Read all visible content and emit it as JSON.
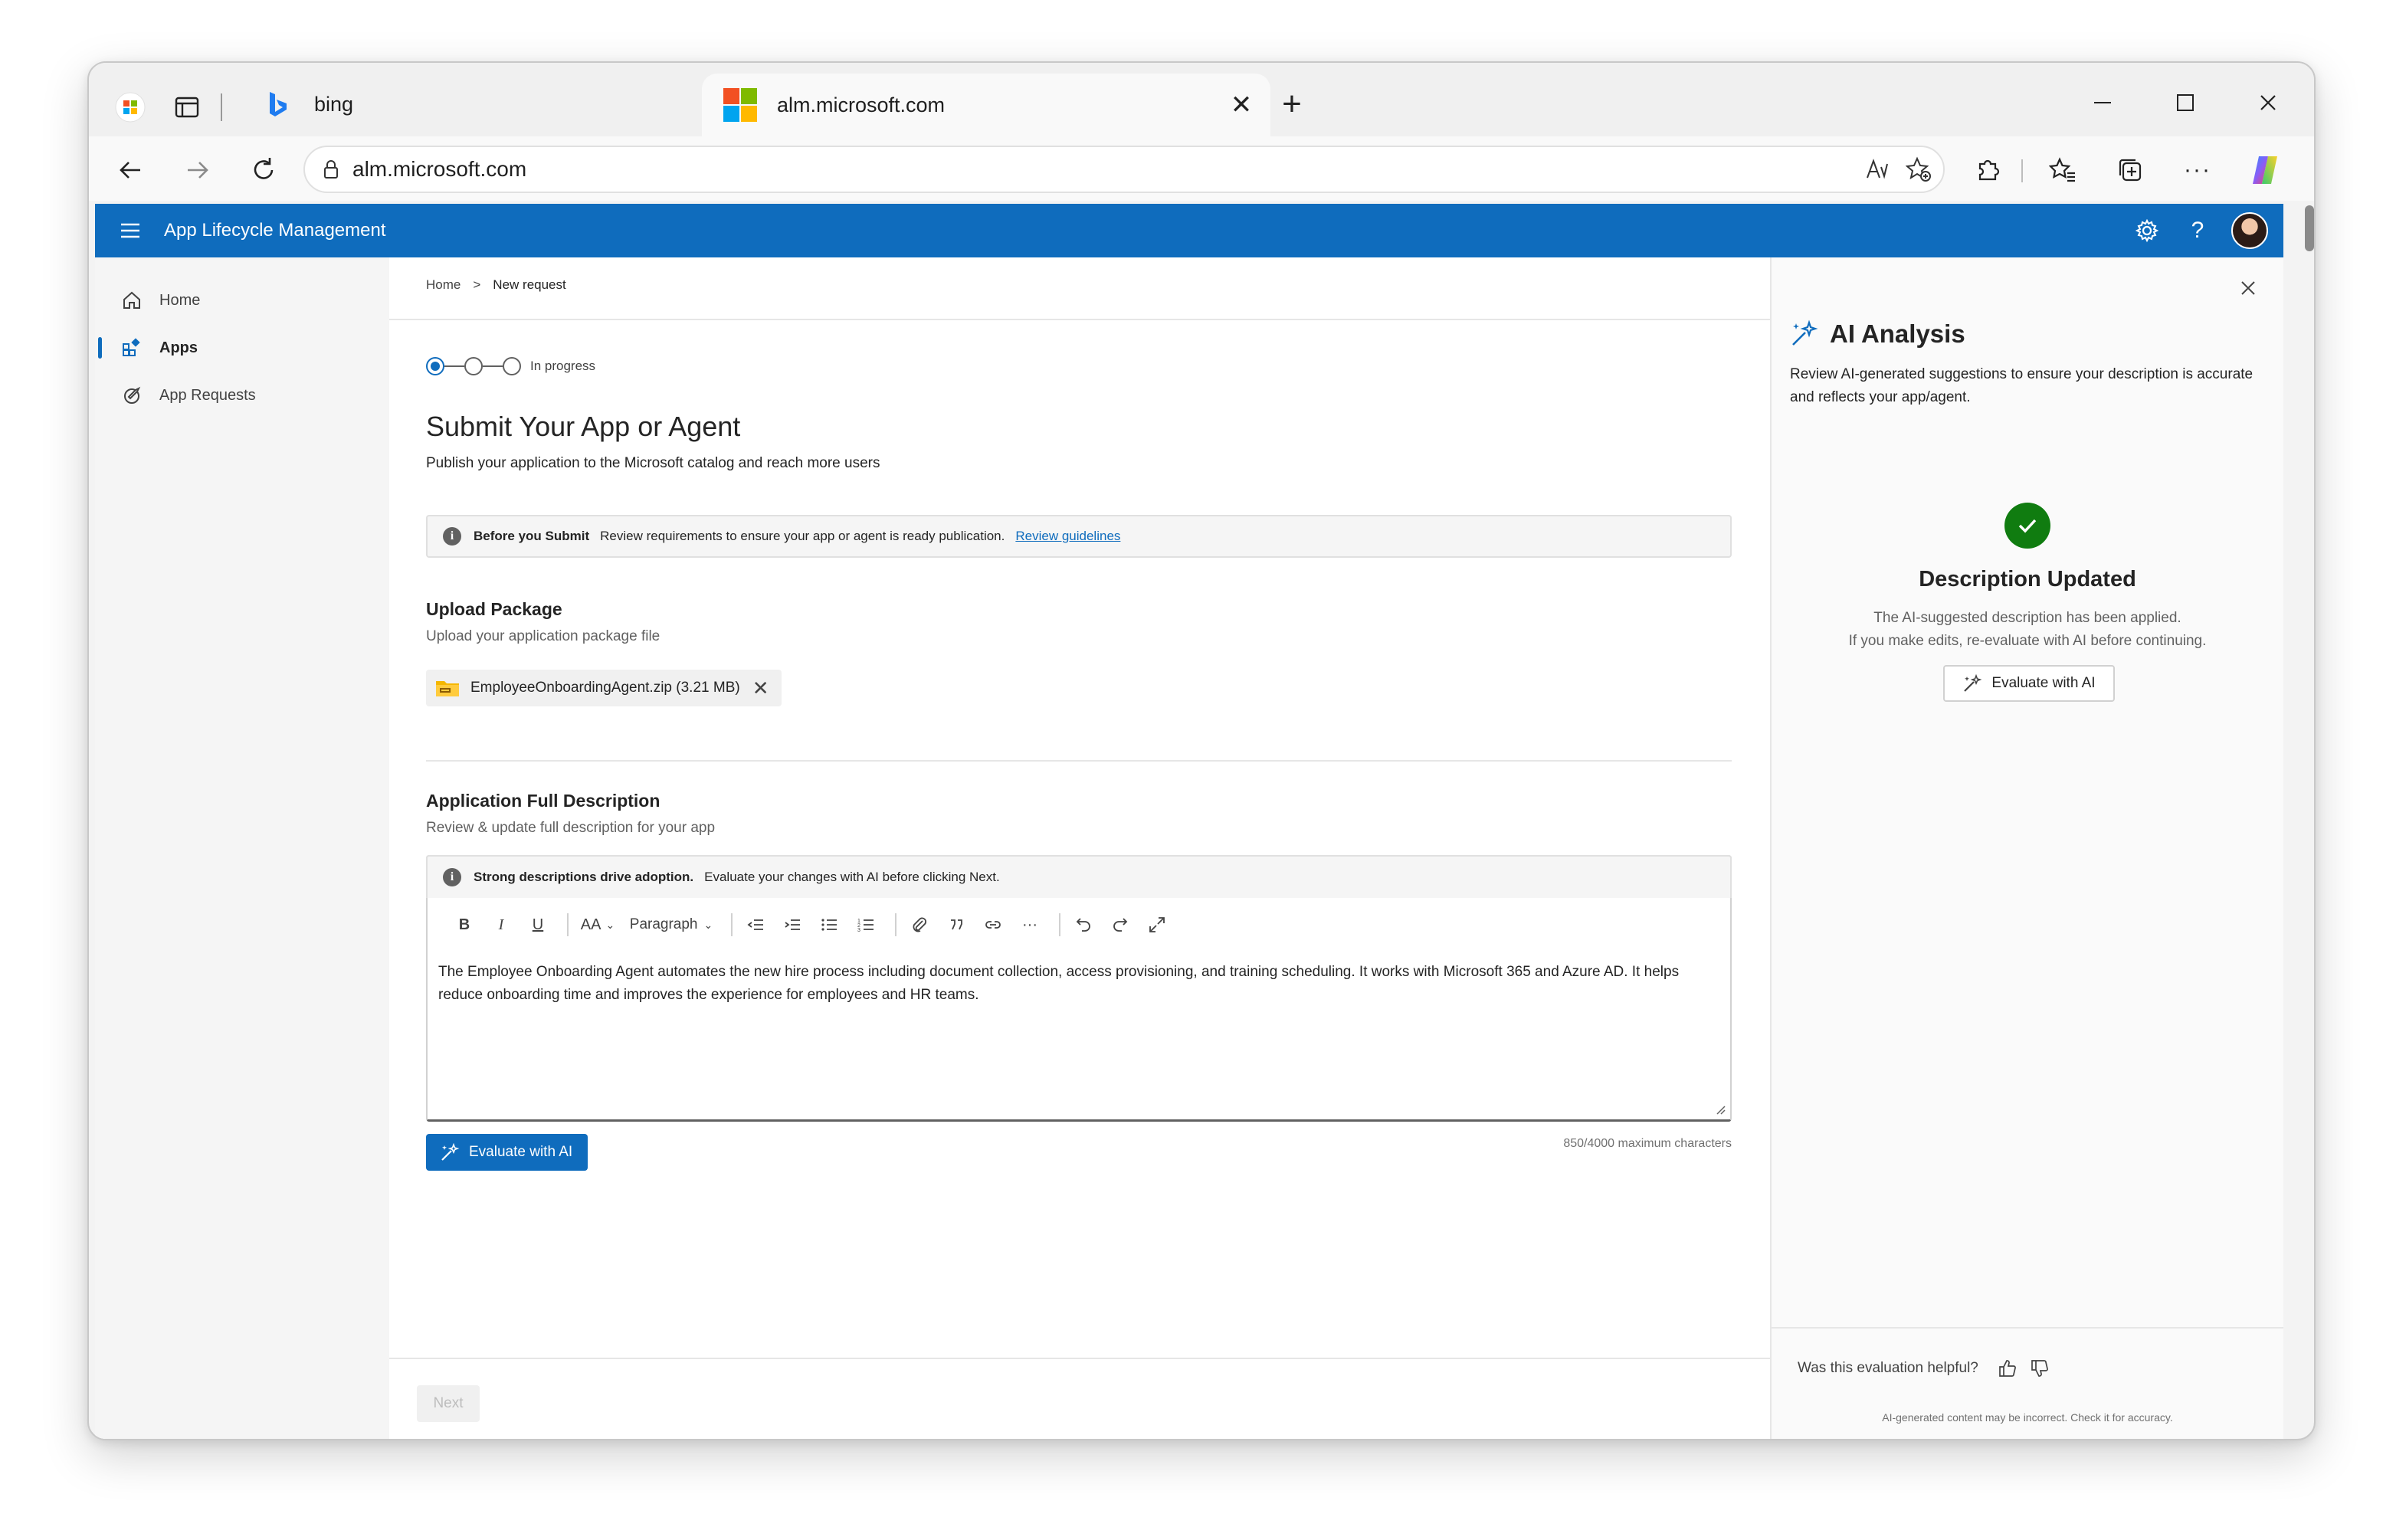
{
  "browser": {
    "tabs": [
      {
        "title": "bing",
        "active": false
      },
      {
        "title": "alm.microsoft.com",
        "active": true
      }
    ],
    "new_tab_label": "+",
    "close_glyph": "✕",
    "address": "alm.microsoft.com"
  },
  "app": {
    "title": "App Lifecycle Management",
    "accent_color": "#0f6cbd",
    "nav": [
      {
        "label": "Home",
        "icon": "home-icon"
      },
      {
        "label": "Apps",
        "icon": "apps-icon",
        "active": true
      },
      {
        "label": "App Requests",
        "icon": "requests-icon"
      }
    ]
  },
  "breadcrumb": {
    "home": "Home",
    "sep": ">",
    "current": "New request"
  },
  "stepper": {
    "status": "In progress",
    "current_step": 1,
    "total_steps": 3
  },
  "page": {
    "title": "Submit Your App or Agent",
    "subtitle": "Publish your application to the Microsoft catalog and reach more users"
  },
  "notice": {
    "title": "Before you Submit",
    "text": "Review requirements to ensure your app or agent is ready publication.",
    "link": "Review guidelines"
  },
  "upload": {
    "title": "Upload Package",
    "subtitle": "Upload your application package file",
    "file_name": "EmployeeOnboardingAgent.zip (3.21 MB)",
    "remove_glyph": "✕"
  },
  "description": {
    "title": "Application Full Description",
    "subtitle": "Review & update full description for your app",
    "notice_title": "Strong descriptions drive adoption.",
    "notice_text": "Evaluate your changes with AI before clicking Next.",
    "toolbar": {
      "bold": "B",
      "italic": "I",
      "underline": "U",
      "font_size": "AA",
      "paragraph": "Paragraph",
      "more": "···"
    },
    "body": "The Employee Onboarding Agent automates the new hire process including document collection, access provisioning, and training scheduling. It works with Microsoft 365 and Azure AD. It helps reduce onboarding time and improves the experience for employees and HR teams.",
    "evaluate_label": "Evaluate with AI",
    "char_count": "850/4000 maximum characters"
  },
  "footer": {
    "next_label": "Next"
  },
  "ai_panel": {
    "title": "AI Analysis",
    "description": "Review AI-generated suggestions to ensure your description is accurate and reflects your app/agent.",
    "status_title": "Description Updated",
    "status_line1": "The AI-suggested description has been applied.",
    "status_line2": "If you make edits, re-evaluate with AI before continuing.",
    "evaluate_label": "Evaluate with AI",
    "feedback_question": "Was this evaluation helpful?",
    "disclaimer": "AI-generated content may be incorrect. Check it for accuracy.",
    "success_color": "#107c10"
  }
}
